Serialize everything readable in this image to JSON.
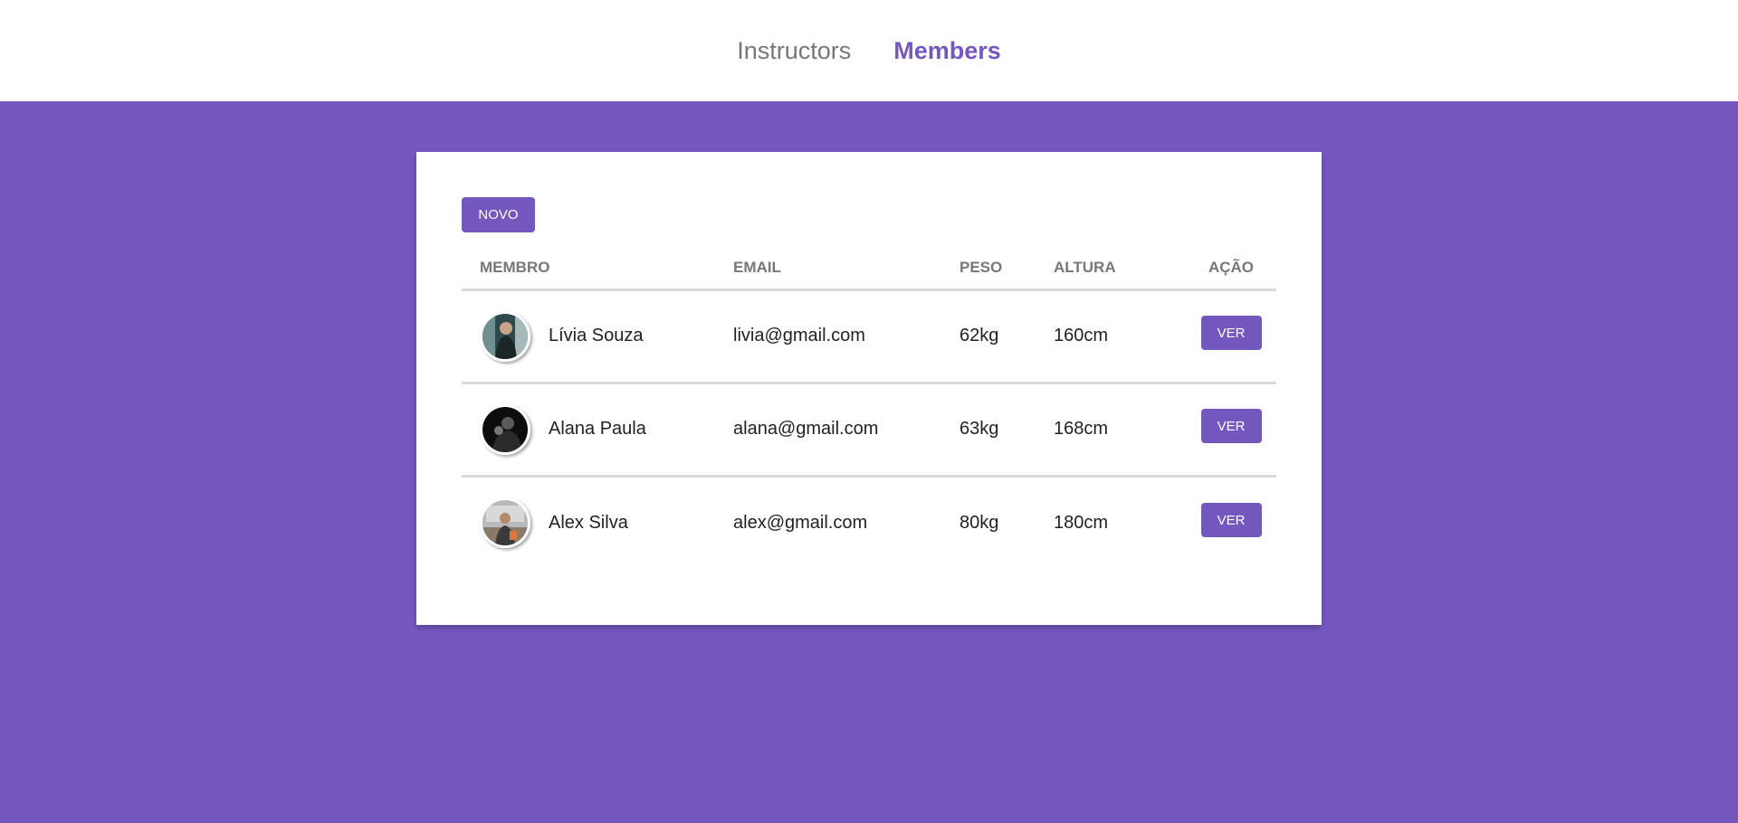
{
  "nav": {
    "links": [
      {
        "label": "Instructors",
        "active": false
      },
      {
        "label": "Members",
        "active": true
      }
    ]
  },
  "toolbar": {
    "new_label": "NOVO"
  },
  "table": {
    "headers": {
      "member": "MEMBRO",
      "email": "EMAIL",
      "weight": "PESO",
      "height": "ALTURA",
      "action": "AÇÃO"
    },
    "rows": [
      {
        "name": "Lívia Souza",
        "email": "livia@gmail.com",
        "weight": "62kg",
        "height": "160cm",
        "action_label": "VER"
      },
      {
        "name": "Alana Paula",
        "email": "alana@gmail.com",
        "weight": "63kg",
        "height": "168cm",
        "action_label": "VER"
      },
      {
        "name": "Alex Silva",
        "email": "alex@gmail.com",
        "weight": "80kg",
        "height": "180cm",
        "action_label": "VER"
      }
    ]
  },
  "colors": {
    "accent": "#7458c0",
    "header_bg": "#ffffff",
    "muted_text": "#777777",
    "divider": "#d9d9d9"
  }
}
